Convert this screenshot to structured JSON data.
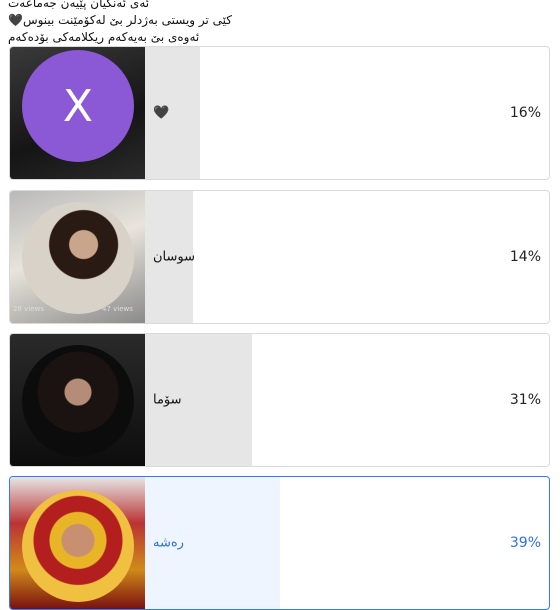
{
  "header": {
    "lines": [
      "ئەی ئەنگیان پێیەن جەماعەت",
      "کێی تر ویستی بەژدلر بێ لەکۆمێنت بینوس🖤",
      "ئەوەی بێ بەیەکەم ریکلامەکی بۆدەکەم"
    ]
  },
  "options": [
    {
      "label": "🖤",
      "percent": "16%",
      "fraction": 0.16,
      "avatar_letter": "X",
      "selected": false
    },
    {
      "label": "سوسان",
      "percent": "14%",
      "fraction": 0.14,
      "selected": false,
      "views_left": "28 views",
      "views_right": "47 views"
    },
    {
      "label": "سۆما",
      "percent": "31%",
      "fraction": 0.31,
      "selected": false
    },
    {
      "label": "رەشە",
      "percent": "39%",
      "fraction": 0.39,
      "selected": true
    }
  ],
  "colors": {
    "accent": "#3478f6",
    "avatar_x": "#8b59d6",
    "bar": "#e6e6e6"
  }
}
